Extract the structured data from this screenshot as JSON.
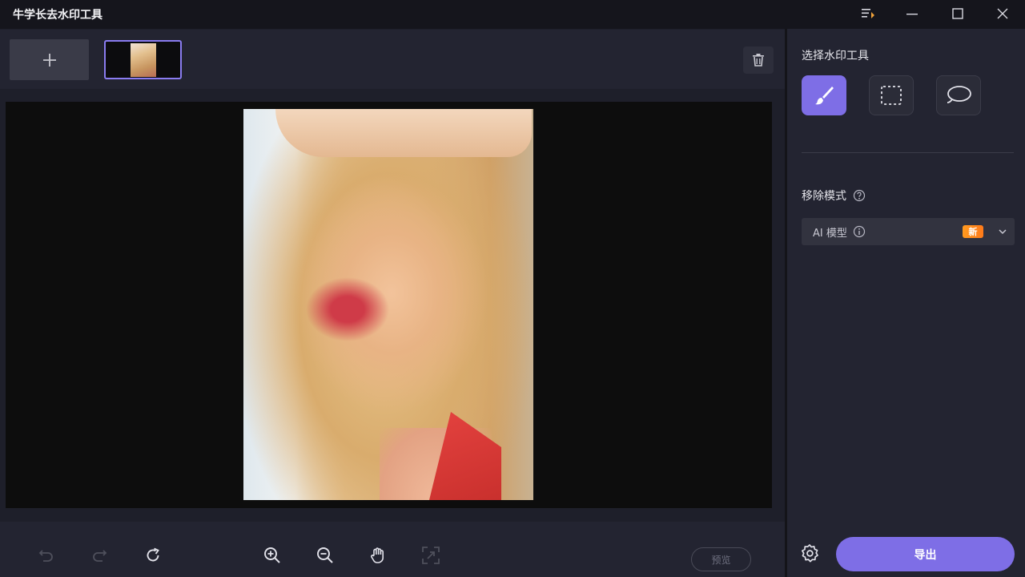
{
  "app": {
    "title": "牛学长去水印工具"
  },
  "window_controls": {
    "items": [
      "menu-icon",
      "minimize-icon",
      "maximize-icon",
      "close-icon"
    ]
  },
  "toolbar": {
    "add_icon": "plus-icon",
    "delete_icon": "trash-icon"
  },
  "bottom_toolbar": {
    "icons": [
      "undo-icon",
      "redo-icon",
      "rotate-icon",
      "zoom-in-icon",
      "zoom-out-icon",
      "hand-icon",
      "fit-icon"
    ],
    "preview_label": "预览"
  },
  "panel": {
    "tool_heading": "选择水印工具",
    "tools": [
      "brush-tool-icon",
      "rect-select-icon",
      "lasso-icon"
    ],
    "active_tool": 0,
    "mode_heading": "移除模式",
    "mode_select": {
      "value": "AI 模型",
      "badge": "新"
    },
    "export_label": "导出"
  },
  "colors": {
    "accent": "#7e6ee6",
    "badge": "#ff8a1c",
    "panel_bg": "#232431",
    "canvas_bg": "#0d0d0d"
  }
}
